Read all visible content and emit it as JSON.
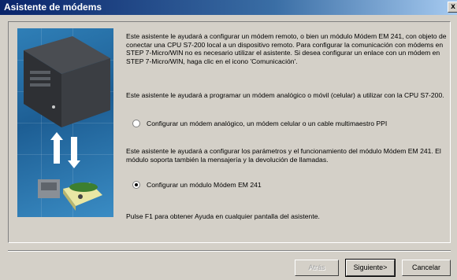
{
  "window": {
    "title": "Asistente de módems",
    "close_label": "x"
  },
  "intro_text": "Este asistente le ayudará a configurar un módem remoto, o bien un módulo Módem EM 241, con objeto de conectar una CPU S7-200 local a un dispositivo remoto. Para configurar la comunicación con módems en STEP 7-Micro/WIN no es necesario utilizar el asistente. Si desea configurar un enlace con un módem en STEP 7-Micro/WIN, haga clic en el icono 'Comunicación'.",
  "section1_text": "Este asistente le ayudará a programar un módem analógico o móvil (celular) a utilizar con la CPU S7-200.",
  "option1_label": "Configurar un módem analógico, un módem celular o un cable multimaestro PPI",
  "section2_text": "Este asistente le ayudará a configurar los parámetros y el funcionamiento del módulo Módem EM 241. El módulo soporta también la mensajería y la devolución de llamadas.",
  "option2_label": "Configurar un módulo Módem EM 241",
  "help_text": "Pulse F1 para obtener Ayuda en cualquier pantalla del asistente.",
  "buttons": {
    "back": "Atrás",
    "next": "Siguiente>",
    "cancel": "Cancelar"
  },
  "selected_option": "option2"
}
